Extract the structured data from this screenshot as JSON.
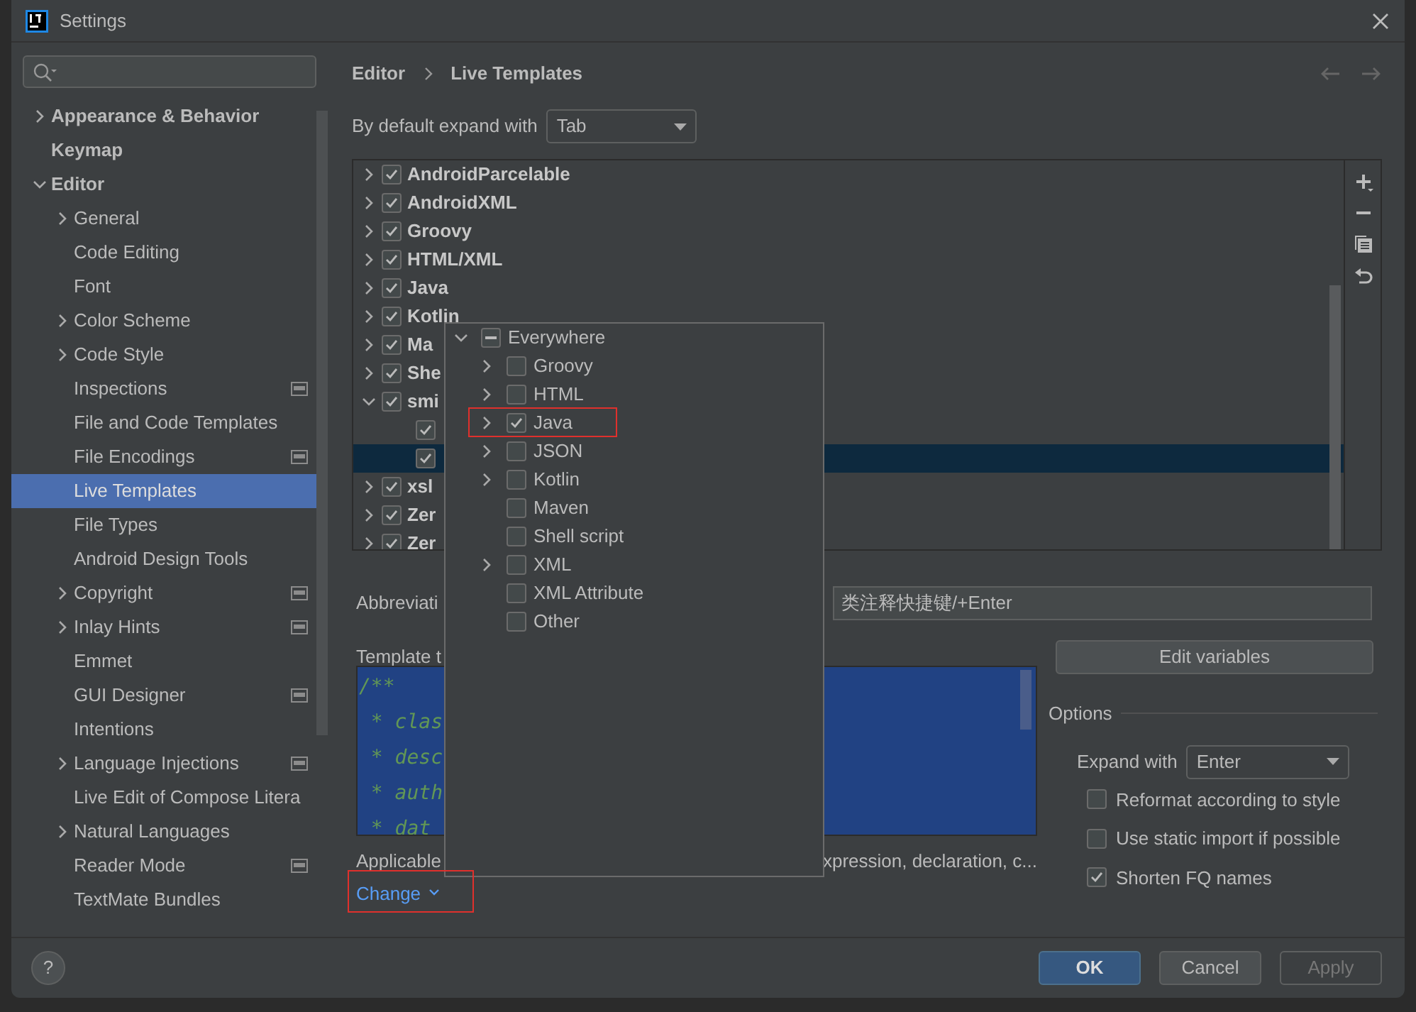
{
  "window": {
    "title": "Settings"
  },
  "sidebar": {
    "items": [
      {
        "label": "Appearance & Behavior",
        "expanded": false,
        "project_icon": false,
        "selected": false
      },
      {
        "label": "Keymap",
        "project_icon": false,
        "selected": false
      },
      {
        "label": "Editor",
        "expanded": true,
        "project_icon": false,
        "selected": false,
        "children": [
          {
            "label": "General",
            "expanded": false,
            "project_icon": false,
            "selected": false
          },
          {
            "label": "Code Editing",
            "project_icon": false,
            "selected": false
          },
          {
            "label": "Font",
            "project_icon": false,
            "selected": false
          },
          {
            "label": "Color Scheme",
            "expanded": false,
            "project_icon": false,
            "selected": false
          },
          {
            "label": "Code Style",
            "expanded": false,
            "project_icon": false,
            "selected": false
          },
          {
            "label": "Inspections",
            "project_icon": true,
            "selected": false
          },
          {
            "label": "File and Code Templates",
            "project_icon": false,
            "selected": false
          },
          {
            "label": "File Encodings",
            "project_icon": true,
            "selected": false
          },
          {
            "label": "Live Templates",
            "project_icon": false,
            "selected": true
          },
          {
            "label": "File Types",
            "project_icon": false,
            "selected": false
          },
          {
            "label": "Android Design Tools",
            "project_icon": false,
            "selected": false
          },
          {
            "label": "Copyright",
            "expanded": false,
            "project_icon": true,
            "selected": false
          },
          {
            "label": "Inlay Hints",
            "expanded": false,
            "project_icon": true,
            "selected": false
          },
          {
            "label": "Emmet",
            "project_icon": false,
            "selected": false
          },
          {
            "label": "GUI Designer",
            "project_icon": true,
            "selected": false
          },
          {
            "label": "Intentions",
            "project_icon": false,
            "selected": false
          },
          {
            "label": "Language Injections",
            "expanded": false,
            "project_icon": true,
            "selected": false
          },
          {
            "label": "Live Edit of Compose Litera",
            "project_icon": false,
            "selected": false
          },
          {
            "label": "Natural Languages",
            "expanded": false,
            "project_icon": false,
            "selected": false
          },
          {
            "label": "Reader Mode",
            "project_icon": true,
            "selected": false
          },
          {
            "label": "TextMate Bundles",
            "project_icon": false,
            "selected": false
          }
        ]
      }
    ]
  },
  "breadcrumb": [
    "Editor",
    "Live Templates"
  ],
  "expand_default": {
    "label": "By default expand with",
    "value": "Tab"
  },
  "template_groups": [
    {
      "label": "AndroidParcelable",
      "checked": true,
      "expanded": false,
      "selected": false
    },
    {
      "label": "AndroidXML",
      "checked": true,
      "expanded": false,
      "selected": false
    },
    {
      "label": "Groovy",
      "checked": true,
      "expanded": false,
      "selected": false
    },
    {
      "label": "HTML/XML",
      "checked": true,
      "expanded": false,
      "selected": false
    },
    {
      "label": "Java",
      "checked": true,
      "expanded": false,
      "selected": false
    },
    {
      "label": "Kotlin",
      "checked": true,
      "expanded": false,
      "selected": false
    },
    {
      "label": "Ma",
      "checked": true,
      "expanded": false,
      "selected": false
    },
    {
      "label": "She",
      "checked": true,
      "expanded": false,
      "selected": false
    },
    {
      "label": "smi",
      "checked": true,
      "expanded": true,
      "selected": false,
      "children": [
        {
          "checked": true,
          "selected": false
        },
        {
          "checked": true,
          "selected": true
        }
      ]
    },
    {
      "label": "xsl",
      "checked": true,
      "expanded": false,
      "selected": false
    },
    {
      "label": "Zer",
      "checked": true,
      "expanded": false,
      "selected": false
    },
    {
      "label": "Zer",
      "checked": true,
      "expanded": false,
      "selected": false
    }
  ],
  "abbreviation": {
    "label": "Abbreviati"
  },
  "description": {
    "value": "类注释快捷键/+Enter"
  },
  "template_text": {
    "label": "Template t",
    "lines": [
      "/**",
      " * clas",
      " * desc",
      " * auth",
      " * dat"
    ]
  },
  "edit_variables": "Edit variables",
  "options": {
    "title": "Options",
    "expand_with": {
      "label": "Expand with",
      "value": "Enter"
    },
    "checkboxes": [
      {
        "label": "Reformat according to style",
        "checked": false
      },
      {
        "label": "Use static import if possible",
        "checked": false
      },
      {
        "label": "Shorten FQ names",
        "checked": true
      }
    ]
  },
  "applicable": {
    "label": "Applicable",
    "contexts": "xpression, declaration, c..."
  },
  "change": {
    "label": "Change",
    "highlighted": true
  },
  "context_popup": {
    "items": [
      {
        "label": "Everywhere",
        "checked": false,
        "indeterminate": true,
        "expanded": true,
        "highlighted": false,
        "children": [
          {
            "label": "Groovy",
            "checked": false,
            "indeterminate": false,
            "expanded": false,
            "highlighted": false
          },
          {
            "label": "HTML",
            "checked": false,
            "indeterminate": false,
            "expanded": false,
            "highlighted": false
          },
          {
            "label": "Java",
            "checked": true,
            "indeterminate": false,
            "expanded": false,
            "highlighted": true
          },
          {
            "label": "JSON",
            "checked": false,
            "indeterminate": false,
            "expanded": false,
            "highlighted": false
          },
          {
            "label": "Kotlin",
            "checked": false,
            "indeterminate": false,
            "expanded": false,
            "highlighted": false
          },
          {
            "label": "Maven",
            "checked": false,
            "indeterminate": false,
            "highlighted": false
          },
          {
            "label": "Shell script",
            "checked": false,
            "indeterminate": false,
            "highlighted": false
          },
          {
            "label": "XML",
            "checked": false,
            "indeterminate": false,
            "expanded": false,
            "highlighted": false
          },
          {
            "label": "XML Attribute",
            "checked": false,
            "indeterminate": false,
            "highlighted": false
          },
          {
            "label": "Other",
            "checked": false,
            "indeterminate": false,
            "highlighted": false
          }
        ]
      }
    ]
  },
  "footer": {
    "help": "?",
    "buttons": [
      {
        "label": "OK",
        "kind": "primary",
        "disabled": false
      },
      {
        "label": "Cancel",
        "kind": "normal",
        "disabled": false
      },
      {
        "label": "Apply",
        "kind": "normal",
        "disabled": true
      }
    ]
  }
}
